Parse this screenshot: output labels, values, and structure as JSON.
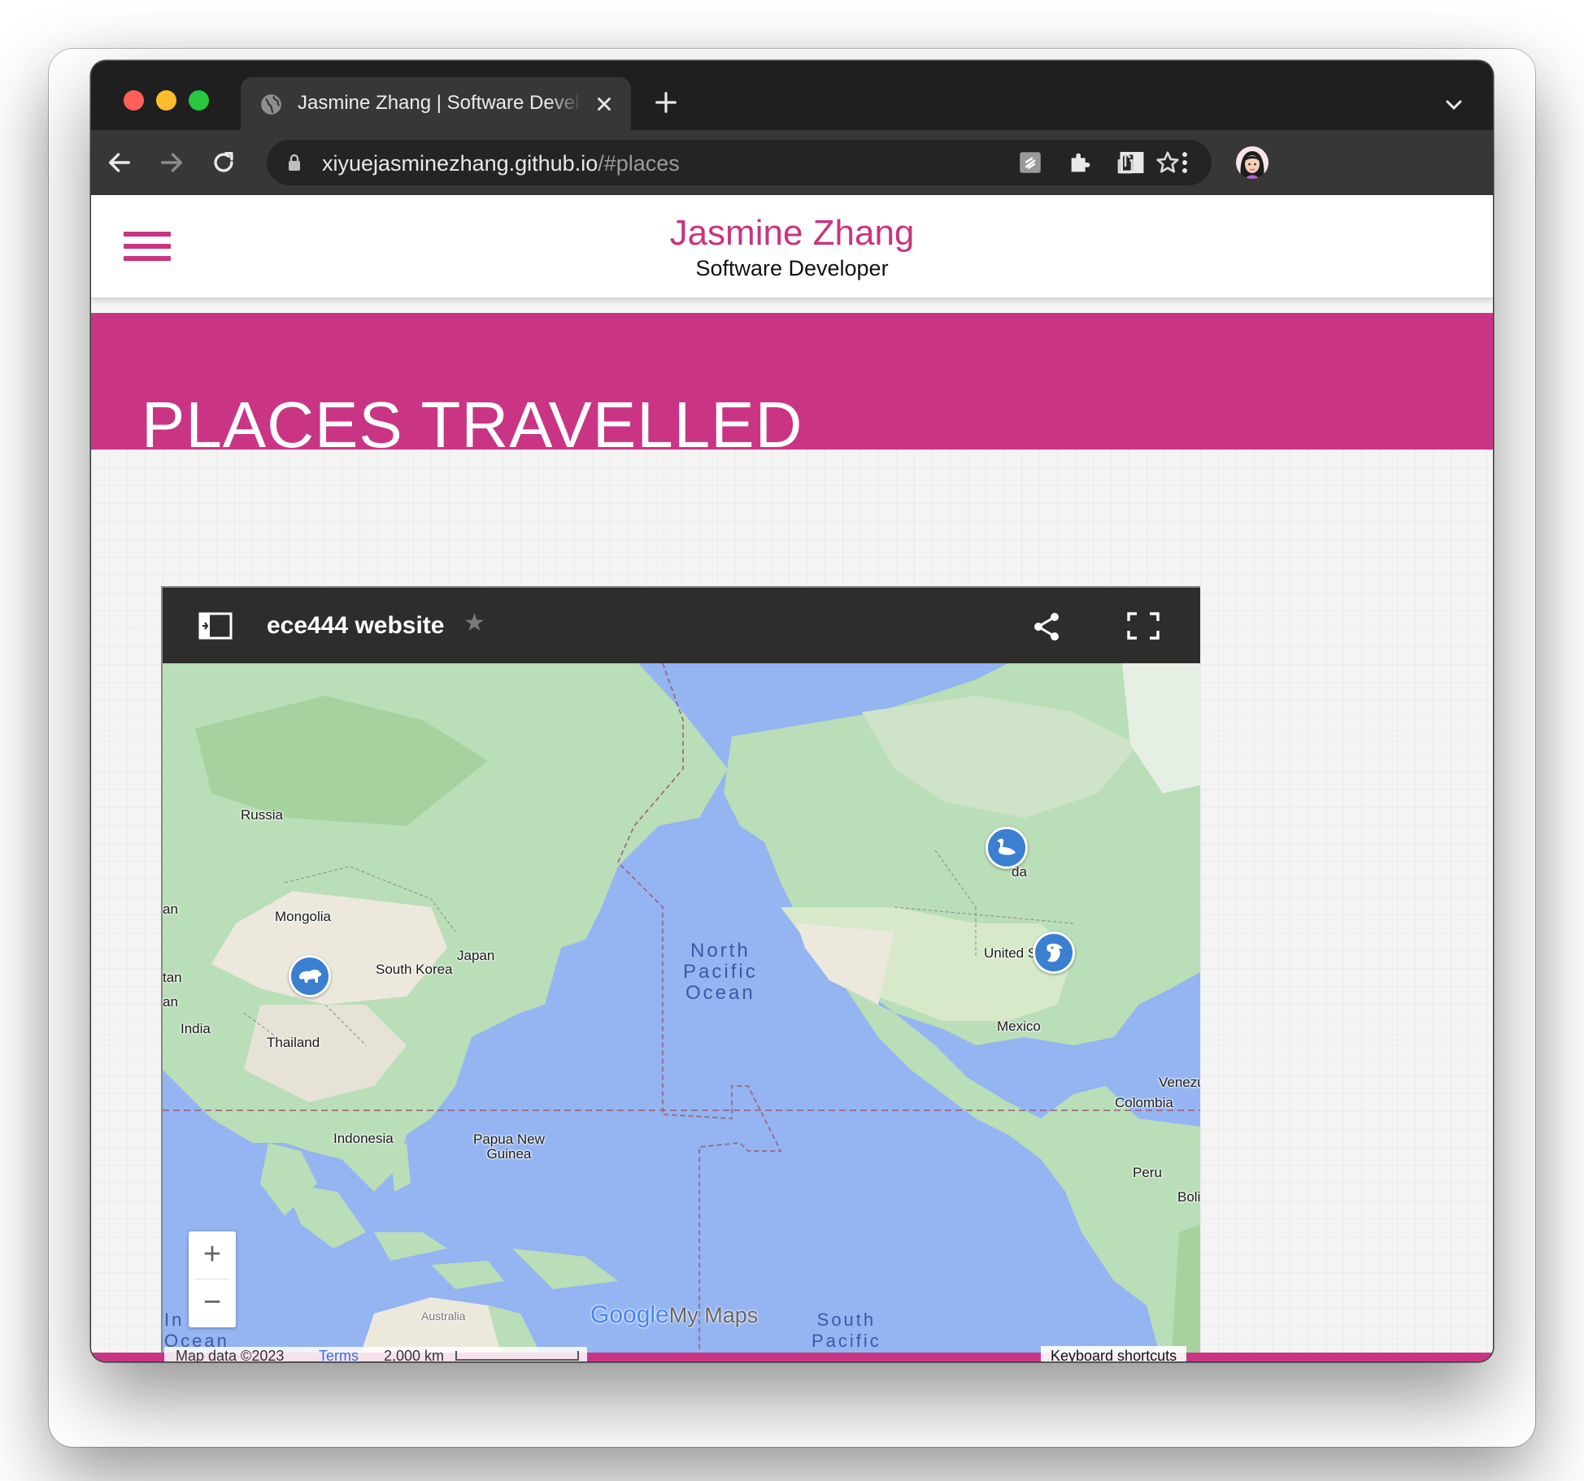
{
  "browser": {
    "tab_title": "Jasmine Zhang | Software Developer",
    "url_host": "xiyuejasminezhang.github.io",
    "url_path": "/#places"
  },
  "site": {
    "name": "Jasmine Zhang",
    "role": "Software Developer",
    "accent_color": "#c93584"
  },
  "section": {
    "title": "PLACES TRAVELLED"
  },
  "map": {
    "title": "ece444 website",
    "labels": {
      "russia": "Russia",
      "mongolia": "Mongolia",
      "japan": "Japan",
      "south_korea": "South Korea",
      "india": "India",
      "thailand": "Thailand",
      "indonesia": "Indonesia",
      "papua": "Papua New\nGuinea",
      "canada_partial": "da",
      "united_states_partial": "United St",
      "mexico": "Mexico",
      "colombia": "Colombia",
      "venezuela_partial": "Venezu",
      "peru": "Peru",
      "bolivia_partial": "Boli",
      "australia": "Australia",
      "edge_an1": "an",
      "edge_tan": "tan",
      "edge_an2": "an"
    },
    "oceans": {
      "north_pacific": "North\nPacific\nOcean",
      "south_pacific": "South\nPacific",
      "indian": "In\nOcean"
    },
    "markers": [
      {
        "name": "china",
        "icon": "polar-bear-icon"
      },
      {
        "name": "canada",
        "icon": "goose-icon"
      },
      {
        "name": "united-states",
        "icon": "eagle-icon"
      }
    ],
    "zoom_in": "+",
    "zoom_out": "−",
    "attribution": "Map data ©2023",
    "terms": "Terms",
    "scale": "2,000 km",
    "keyboard_shortcuts": "Keyboard shortcuts",
    "brand_google": "Google",
    "brand_mymaps": "My Maps"
  }
}
